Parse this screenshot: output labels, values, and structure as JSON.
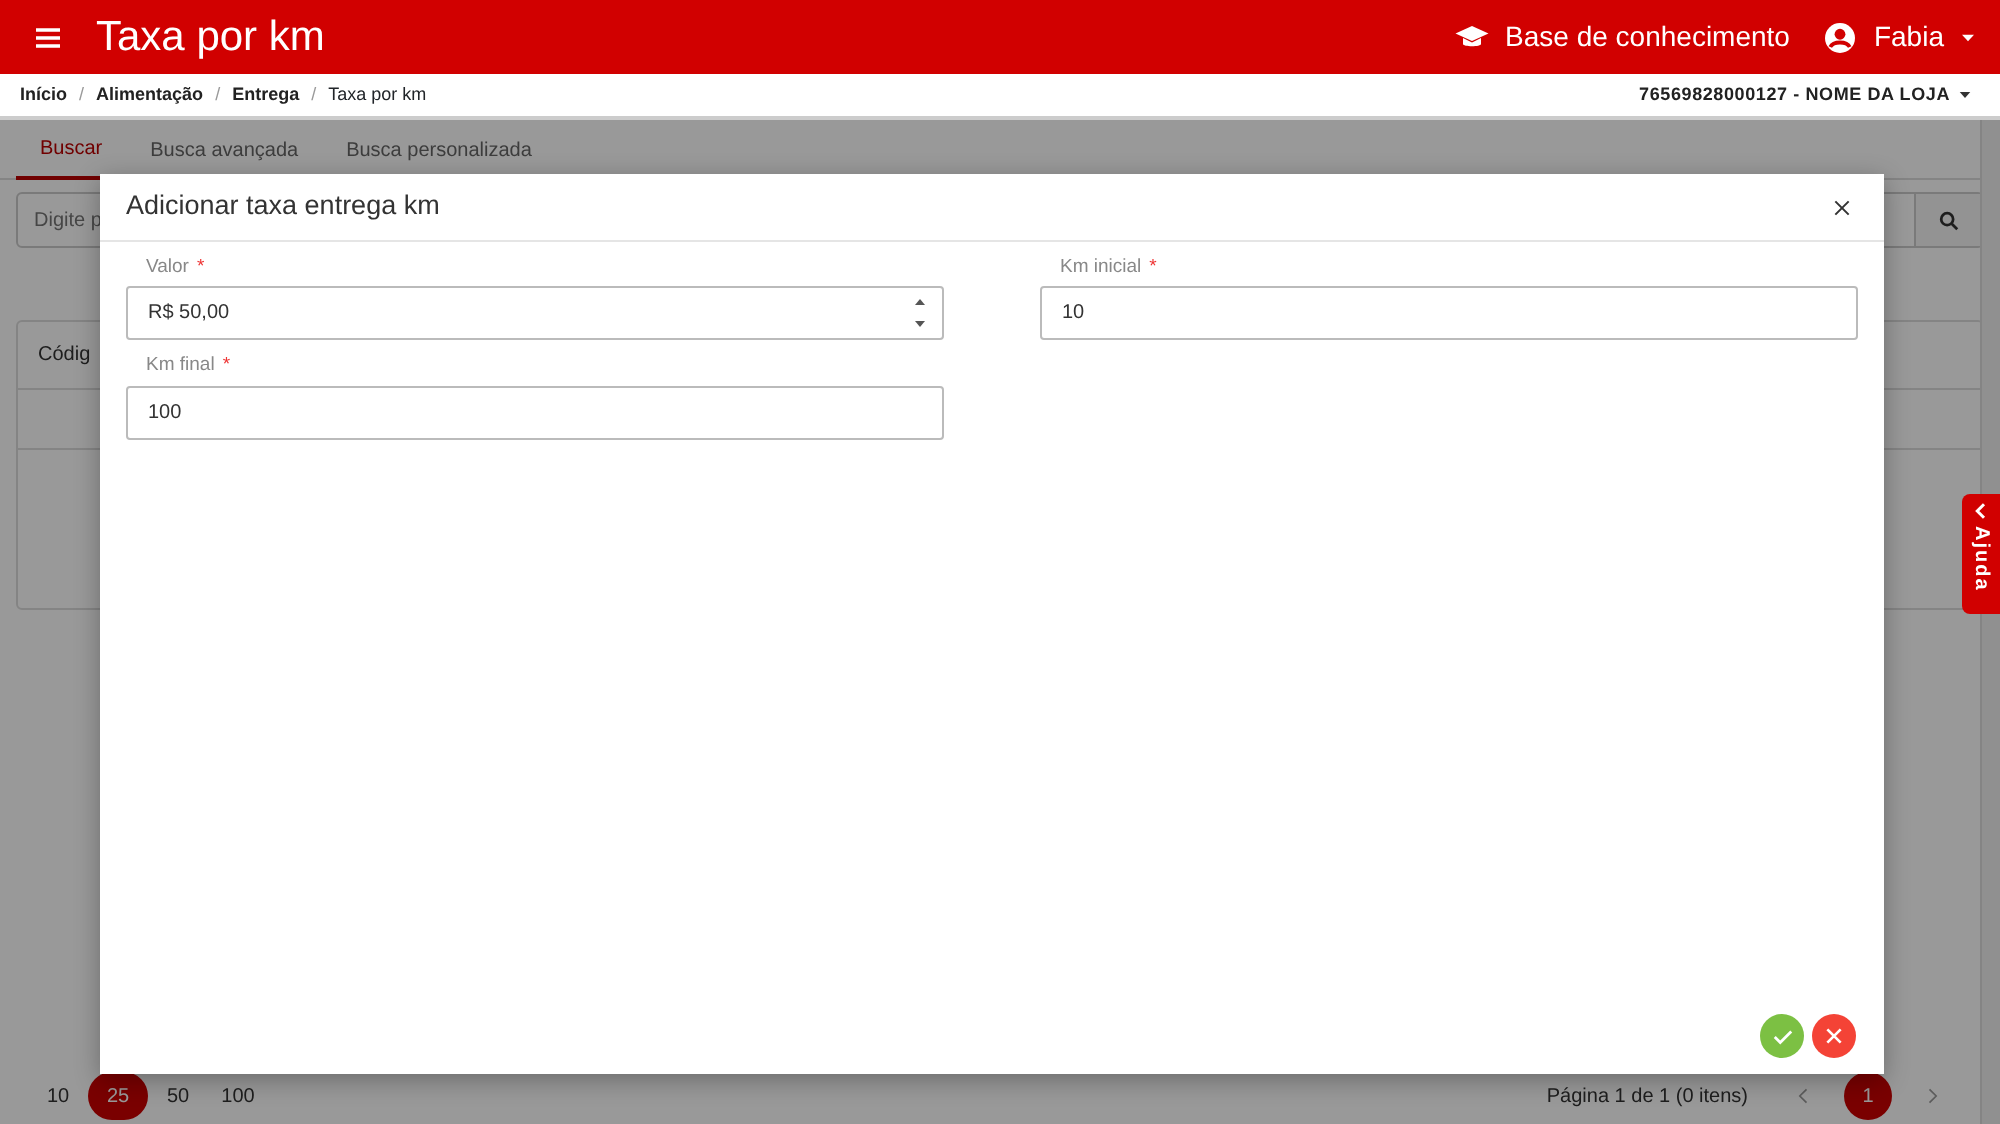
{
  "header": {
    "title": "Taxa por km",
    "links": [
      {
        "label": "Base de conhecimento",
        "kind": "knowledge"
      },
      {
        "label": "Fabia",
        "kind": "user"
      }
    ]
  },
  "breadcrumb": {
    "separator": "/",
    "items": [
      "Início",
      "Alimentação",
      "Entrega",
      "Taxa por km"
    ]
  },
  "store": "76569828000127 - NOME DA LOJA",
  "tabs": [
    {
      "label": "Buscar",
      "selected": true
    },
    {
      "label": "Busca avançada",
      "selected": false
    },
    {
      "label": "Busca personalizada",
      "selected": false
    }
  ],
  "search": {
    "placeholder": "Digite p"
  },
  "table": {
    "columns": [
      "Códig"
    ]
  },
  "pagination": {
    "sizes": [
      {
        "label": "10",
        "selected": false
      },
      {
        "label": "25",
        "selected": true
      },
      {
        "label": "50",
        "selected": false
      },
      {
        "label": "100",
        "selected": false
      }
    ],
    "summary": "Página 1 de 1 (0 itens)",
    "pages": [
      {
        "label": "1",
        "selected": true
      }
    ]
  },
  "help_tab": {
    "label": "Ajuda"
  },
  "dialog": {
    "title": "Adicionar taxa entrega km",
    "required_mark": "*",
    "fields": [
      {
        "label": "Valor",
        "required": true,
        "value": "R$ 50,00",
        "kind": "spinner"
      },
      {
        "label": "Km inicial",
        "required": true,
        "value": "10",
        "kind": "text"
      },
      {
        "label": "Km final",
        "required": true,
        "value": "100",
        "kind": "text"
      }
    ],
    "buttons": [
      {
        "kind": "confirm"
      },
      {
        "kind": "cancel"
      }
    ]
  }
}
